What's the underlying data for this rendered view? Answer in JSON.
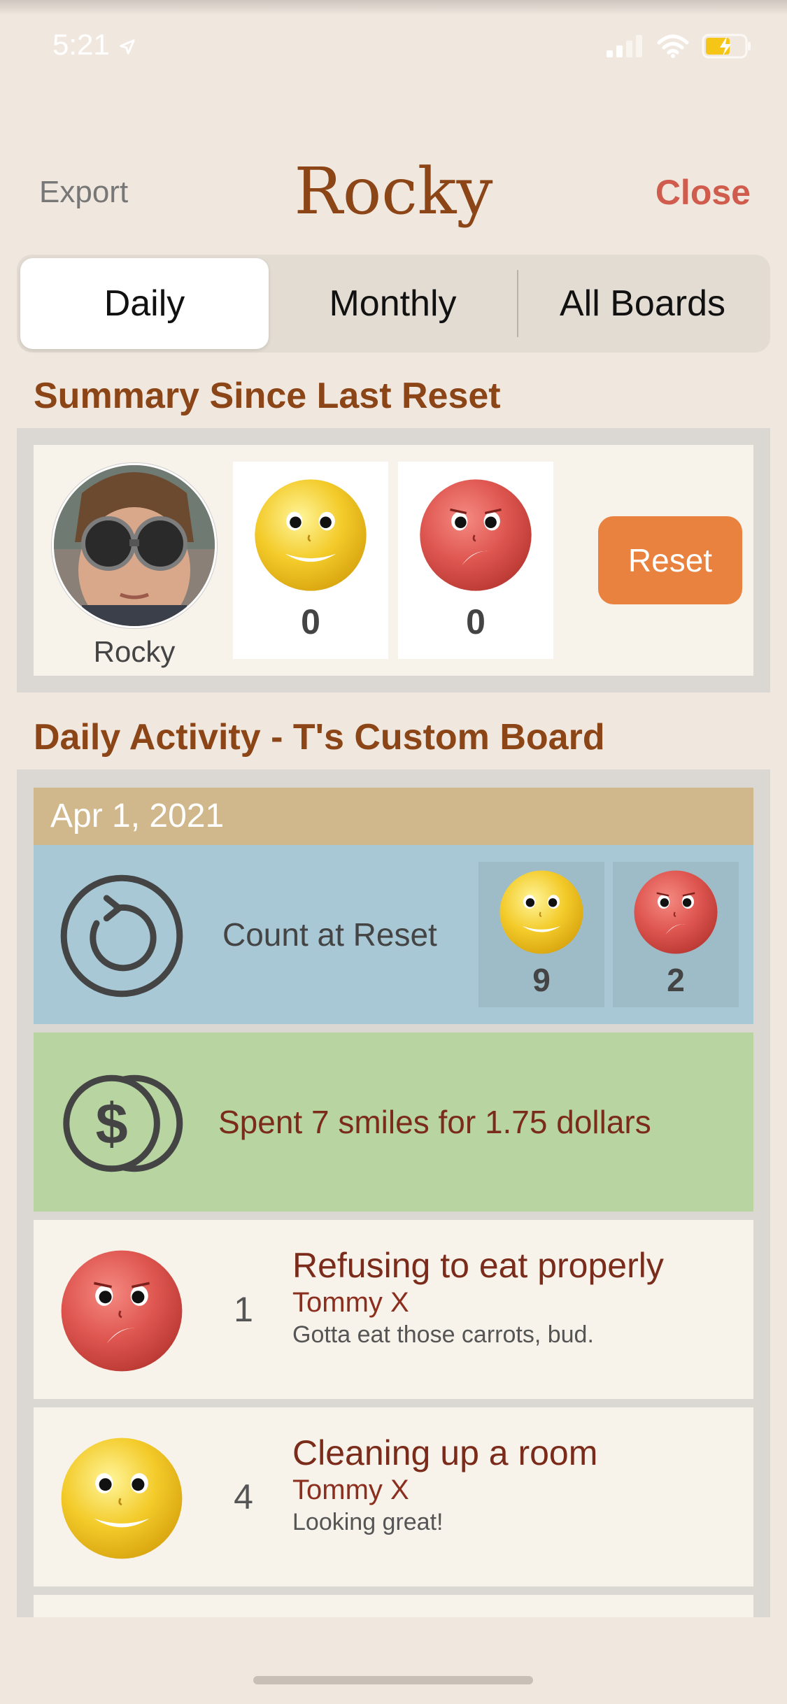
{
  "status_bar": {
    "time": "5:21"
  },
  "nav": {
    "export_label": "Export",
    "title": "Rocky",
    "close_label": "Close"
  },
  "tabs": [
    {
      "label": "Daily",
      "active": true
    },
    {
      "label": "Monthly",
      "active": false
    },
    {
      "label": "All Boards",
      "active": false
    }
  ],
  "summary": {
    "heading": "Summary Since Last Reset",
    "child_name": "Rocky",
    "smile_count": "0",
    "frown_count": "0",
    "reset_label": "Reset"
  },
  "activity": {
    "heading": "Daily Activity - T's Custom Board",
    "date": "Apr 1, 2021",
    "reset_row": {
      "label": "Count at Reset",
      "smile_count": "9",
      "frown_count": "2"
    },
    "spent_row": {
      "label": "Spent 7 smiles for 1.75 dollars"
    },
    "entries": [
      {
        "face": "frown",
        "count": "1",
        "title": "Refusing to eat properly",
        "user": "Tommy X",
        "note": "Gotta eat those carrots, bud."
      },
      {
        "face": "smile",
        "count": "4",
        "title": "Cleaning up a room",
        "user": "Tommy X",
        "note": "Looking great!"
      }
    ]
  },
  "colors": {
    "accent": "#8b4517",
    "close": "#cf5c4c",
    "reset_button": "#e8823e",
    "smile": "#f3cb2a",
    "frown": "#df5650"
  },
  "icons": [
    "location-arrow-icon",
    "signal-icon",
    "wifi-icon",
    "battery-charging-icon",
    "reset-clock-icon",
    "dollar-coins-icon",
    "smile-face-icon",
    "frown-face-icon"
  ]
}
